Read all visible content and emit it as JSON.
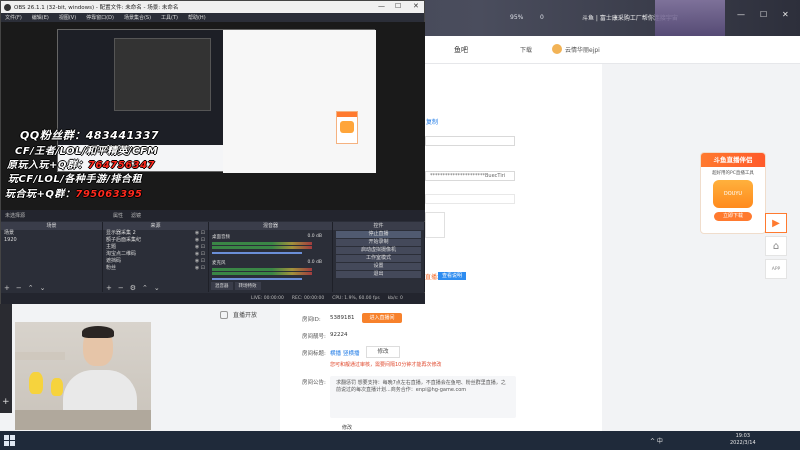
{
  "browser": {
    "zoom": "95%",
    "coin_label": "0",
    "top_slogan": "斗鱼 | 富士康采购工厂帮你连接宇宙",
    "header": {
      "logo_text": "鱼吧",
      "download": "下载",
      "username": "云情华丽ejpi"
    },
    "sidebar_items": [
      {
        "label": "直播开放"
      }
    ],
    "fields": {
      "room_id_label": "房间ID:",
      "room_id_value": "5389181",
      "enter_room_btn": "进入直播间",
      "room_number_label": "房间靓号:",
      "room_number_value": "92224",
      "room_tag_label": "房间标题:",
      "mode_links": [
        "横播",
        "竖横播"
      ],
      "modify_btn": "修改",
      "warn_text": "您可和靓通过审核，需要间隔10分钟才能再次修改",
      "notice_label": "房间公告:",
      "notice_text": "求翻惩罚 想要支持：每晚7点左右直播，不直播会在鱼吧、粉丝群里直播，之前说过的每次直播计划...商务合作：enpi@hg-game.com",
      "notice_edit": "修改"
    },
    "stream_key_masked": "**********************BuecTiri",
    "link_text": "复制",
    "link2": "直播地址",
    "link3": "查看说明",
    "ad": {
      "title": "斗鱼直播伴侣",
      "subtitle": "超好用的PC直播工具",
      "logo_text": "DOUYU",
      "button": "立即下载"
    }
  },
  "obs": {
    "title": "OBS 26.1.1 (32-bit, windows) - 配置文件: 未命名 - 场景: 未命名",
    "menu": [
      "文件(F)",
      "编辑(E)",
      "视图(V)",
      "停靠窗口(D)",
      "场景集合(S)",
      "工具(T)",
      "帮助(H)"
    ],
    "status_row": {
      "source": "未选择源",
      "properties": "属性",
      "filters": "滤镜"
    },
    "scenes_header": "场景",
    "scenes": [
      "场景",
      "1920"
    ],
    "sources_header": "来源",
    "sources": [
      "显示器采集 2",
      "额子后面采集纪",
      "主题",
      "淘宝点二维码",
      "遮挡码",
      "粉丝"
    ],
    "mixer_header": "混音器",
    "mixer": [
      {
        "name": "桌面音频",
        "db": "0.0 dB"
      },
      {
        "name": "麦克风",
        "db": "0.0 dB"
      }
    ],
    "controls_header": "控件",
    "controls": [
      "停止直播",
      "开始录制",
      "启动虚拟摄像机",
      "工作室模式",
      "设置",
      "退出"
    ],
    "bottom_tabs": [
      "混音器",
      "转场特效"
    ],
    "statusbar": {
      "dropped": "LIVE: 00:00:00",
      "rec": "REC: 00:00:00",
      "cpu": "CPU: 1.9%, 60.00 fps",
      "bitrate": "kb/s: 0"
    },
    "overlay": {
      "line1": "QQ粉丝群：483441337",
      "line2": "CF/王者/LOL/和平精英/CFM",
      "line3a": "原玩入玩+Q群：",
      "line3b": "764756347",
      "line4": "玩CF/LOL/各种手游/排合租",
      "line5a": "玩合玩+Q群：",
      "line5b": "795063395"
    }
  },
  "taskbar": {
    "time": "19:03",
    "date": "2022/3/14",
    "tray": "^ 中"
  },
  "colors": {
    "accent_orange": "#ff7a2f",
    "link_blue": "#1e7ae6",
    "obs_bg": "#2b2e38",
    "overlay_red": "#ff2a1e"
  }
}
